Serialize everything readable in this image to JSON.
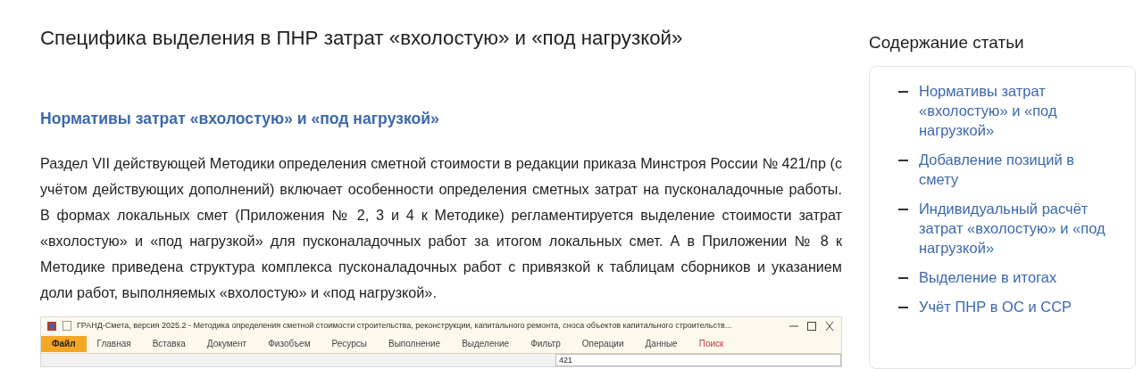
{
  "article": {
    "title": "Специфика выделения в ПНР затрат «вхолостую» и «под нагрузкой»",
    "section_heading": "Нормативы затрат «вхолостую» и «под нагрузкой»",
    "paragraph": "Раздел VII действующей Методики определения сметной стоимости в редакции приказа Минстроя России № 421/пр (с учётом действующих дополнений) включает особенности определения сметных затрат на пусконаладочные работы. В формах локальных смет (Приложения № 2, 3 и 4 к Методике) регламентируется выделение стоимости затрат «вхолостую» и «под нагрузкой» для пусконаладочных работ за итогом локальных смет. А в Приложении № 8 к Методике приведена структура комплекса пусконаладочных работ с привязкой к таблицам сборников и указанием доли работ, выполняемых «вхолостую» и «под нагрузкой».",
    "app_screenshot": {
      "window_title": "ГРАНД-Смета, версия 2025.2 - Методика определения сметной стоимости строительства, реконструкции, капитального ремонта, сноса объектов капитального строительств...",
      "ribbon_tabs": [
        {
          "label": "Файл",
          "selected": true,
          "kind": "file"
        },
        {
          "label": "Главная",
          "selected": false,
          "kind": "tab"
        },
        {
          "label": "Вставка",
          "selected": false,
          "kind": "tab"
        },
        {
          "label": "Документ",
          "selected": false,
          "kind": "tab"
        },
        {
          "label": "Физобъем",
          "selected": false,
          "kind": "tab"
        },
        {
          "label": "Ресурсы",
          "selected": false,
          "kind": "tab"
        },
        {
          "label": "Выполнение",
          "selected": false,
          "kind": "tab"
        },
        {
          "label": "Выделение",
          "selected": false,
          "kind": "tab"
        },
        {
          "label": "Фильтр",
          "selected": false,
          "kind": "tab"
        },
        {
          "label": "Операции",
          "selected": false,
          "kind": "tab"
        },
        {
          "label": "Данные",
          "selected": false,
          "kind": "tab"
        },
        {
          "label": "Поиск",
          "selected": false,
          "kind": "search"
        }
      ],
      "search_value": "421"
    }
  },
  "sidebar": {
    "title": "Содержание статьи",
    "items": [
      {
        "label": "Нормативы затрат «вхолостую» и «под нагрузкой»"
      },
      {
        "label": "Добавление позиций в смету"
      },
      {
        "label": "Индивидуальный расчёт затрат «вхолостую» и «под нагрузкой»"
      },
      {
        "label": "Выделение в итогах"
      },
      {
        "label": "Учёт ПНР в ОС и ССР"
      }
    ]
  }
}
